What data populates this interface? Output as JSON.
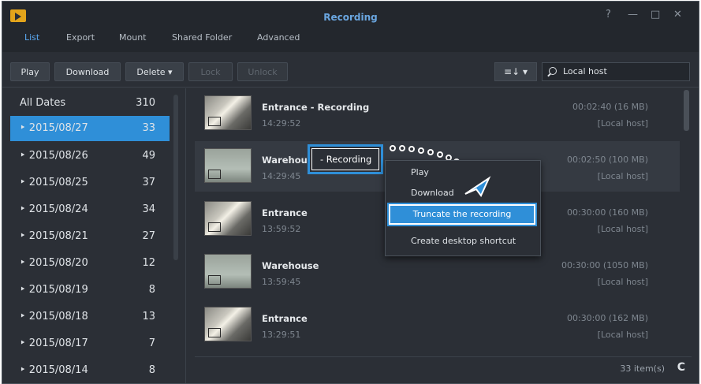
{
  "window": {
    "title": "Recording",
    "controls": [
      "?",
      "—",
      "□",
      "✕"
    ]
  },
  "tabs": [
    {
      "label": "List",
      "active": true
    },
    {
      "label": "Export",
      "active": false
    },
    {
      "label": "Mount",
      "active": false
    },
    {
      "label": "Shared Folder",
      "active": false
    },
    {
      "label": "Advanced",
      "active": false
    }
  ],
  "toolbar": {
    "play": "Play",
    "download": "Download",
    "delete": "Delete ▾",
    "lock": "Lock",
    "unlock": "Unlock",
    "sort_icon": "≡↓ ▾",
    "search_value": "Local host"
  },
  "sidebar": {
    "header": {
      "label": "All Dates",
      "count": "310"
    },
    "dates": [
      {
        "label": "‣ 2015/08/27",
        "count": "33",
        "selected": true
      },
      {
        "label": "‣ 2015/08/26",
        "count": "49"
      },
      {
        "label": "‣ 2015/08/25",
        "count": "37"
      },
      {
        "label": "‣ 2015/08/24",
        "count": "34"
      },
      {
        "label": "‣ 2015/08/21",
        "count": "27"
      },
      {
        "label": "‣ 2015/08/20",
        "count": "12"
      },
      {
        "label": "‣ 2015/08/19",
        "count": "8"
      },
      {
        "label": "‣ 2015/08/18",
        "count": "13"
      },
      {
        "label": "‣ 2015/08/17",
        "count": "7"
      },
      {
        "label": "‣ 2015/08/14",
        "count": "8"
      }
    ]
  },
  "recordings": [
    {
      "name": "Entrance - Recording",
      "time": "14:29:52",
      "duration": "00:02:40 (16 MB)",
      "host": "[Local host]"
    },
    {
      "name": "Warehous",
      "time": "14:29:45",
      "duration": "00:02:50 (100 MB)",
      "host": "[Local host]"
    },
    {
      "name": "Entrance",
      "time": "13:59:52",
      "duration": "00:30:00 (160 MB)",
      "host": "[Local host]"
    },
    {
      "name": "Warehouse",
      "time": "13:59:45",
      "duration": "00:30:00 (1050 MB)",
      "host": "[Local host]"
    },
    {
      "name": "Entrance",
      "time": "13:29:51",
      "duration": "00:30:00 (162 MB)",
      "host": "[Local host]"
    }
  ],
  "recording_callout": "- Recording",
  "context_menu": {
    "play": "Play",
    "download": "Download",
    "truncate": "Truncate the recording",
    "shortcut": "Create desktop shortcut"
  },
  "footer": {
    "items": "33 item(s)",
    "refresh": "C"
  },
  "colors": {
    "accent": "#2f8fd8",
    "background": "#2b2f36",
    "title": "#6aa6e0"
  }
}
